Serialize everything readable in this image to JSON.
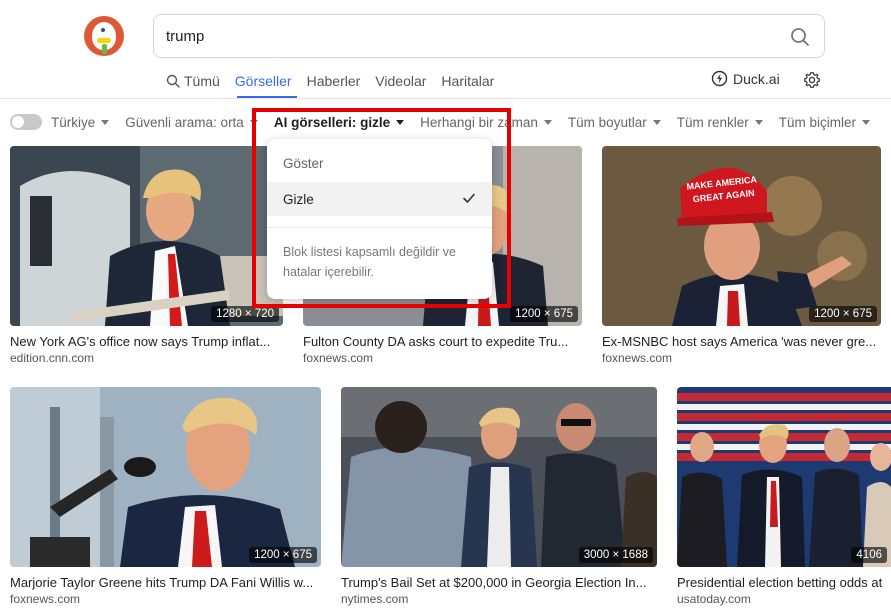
{
  "search": {
    "query": "trump"
  },
  "tabs": [
    {
      "label": "Tümü",
      "icon": "search-icon"
    },
    {
      "label": "Görseller"
    },
    {
      "label": "Haberler"
    },
    {
      "label": "Videolar"
    },
    {
      "label": "Haritalar"
    }
  ],
  "duckai": {
    "label": "Duck.ai"
  },
  "filters": {
    "region": "Türkiye",
    "safe_search": "Güvenli arama: orta",
    "ai_images": "AI görselleri: gizle",
    "time": "Herhangi bir zaman",
    "size": "Tüm boyutlar",
    "color": "Tüm renkler",
    "format": "Tüm biçimler"
  },
  "dropdown": {
    "items": [
      {
        "label": "Göster",
        "selected": false
      },
      {
        "label": "Gizle",
        "selected": true
      }
    ],
    "note": "Blok listesi kapsamlı değildir ve hatalar içerebilir."
  },
  "results": [
    {
      "title": "New York AG's office now says Trump inflat...",
      "source": "edition.cnn.com",
      "dims": "1280 × 720"
    },
    {
      "title": "Fulton County DA asks court to expedite Tru...",
      "source": "foxnews.com",
      "dims": "1200 × 675"
    },
    {
      "title": "Ex-MSNBC host says America 'was never gre...",
      "source": "foxnews.com",
      "dims": "1200 × 675"
    },
    {
      "title": "Marjorie Taylor Greene hits Trump DA Fani Willis w...",
      "source": "foxnews.com",
      "dims": "1200 × 675"
    },
    {
      "title": "Trump's Bail Set at $200,000 in Georgia Election In...",
      "source": "nytimes.com",
      "dims": "3000 × 1688"
    },
    {
      "title": "Presidential election betting odds at",
      "source": "usatoday.com",
      "dims": "4106"
    }
  ],
  "hat_text": "MAKE AMERICA GREAT AGAIN",
  "colors": {
    "accent": "#3969ef",
    "highlight": "#e60000",
    "logo": "#de5833"
  }
}
